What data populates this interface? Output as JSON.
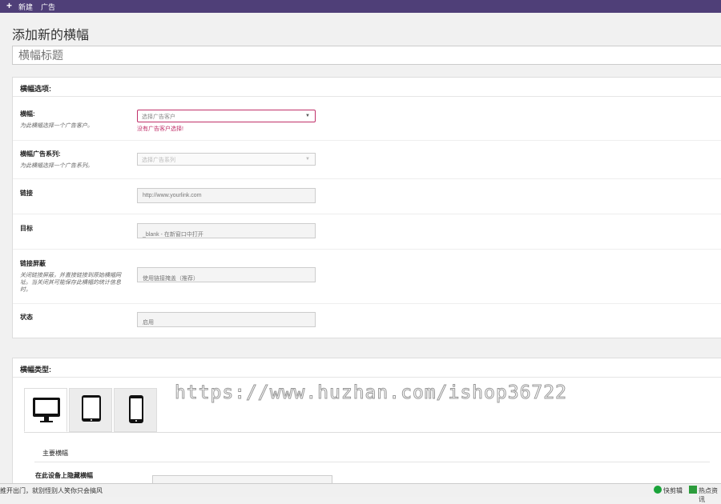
{
  "topbar": {
    "plus_icon": "plus-icon",
    "new_label": "新建",
    "ad_label": "广告"
  },
  "page": {
    "title": "添加新的横幅",
    "title_placeholder": "横幅标题"
  },
  "options": {
    "heading": "横幅选项:",
    "client": {
      "label": "横幅:",
      "desc": "为此横幅选择一个广告客户。",
      "value": "选择广告客户",
      "error": "没有广告客户选择!"
    },
    "campaign": {
      "label": "横幅广告系列:",
      "desc": "为此横幅选择一个广告系列。",
      "value": "选择广告系列"
    },
    "link": {
      "label": "链接",
      "placeholder": "http://www.yourlink.com"
    },
    "target": {
      "label": "目标",
      "value": "_blank - 在新窗口中打开"
    },
    "masking": {
      "label": "链接屏蔽",
      "desc": "关闭链接屏蔽，并直接链接到原始横幅网址。当关闭其可能保存此横幅的统计信息时。",
      "value": "使用链接掩盖（推荐）"
    },
    "status": {
      "label": "状态",
      "value": "启用"
    }
  },
  "types": {
    "heading": "横幅类型:",
    "tabs": [
      {
        "icon": "desktop-icon"
      },
      {
        "icon": "tablet-icon"
      },
      {
        "icon": "mobile-icon"
      }
    ],
    "sub_heading": "主要横幅",
    "hide_label": "在此设备上隐藏横幅"
  },
  "watermark": "https://www.huzhan.com/ishop36722",
  "statusbar": {
    "left_text": "推开出门，就别怪别人笑你只会搞风",
    "quick_clip": "快剪辑",
    "hot_news": "热点资讯"
  },
  "colors": {
    "topbar": "#4f3f78",
    "error": "#c0306a"
  }
}
